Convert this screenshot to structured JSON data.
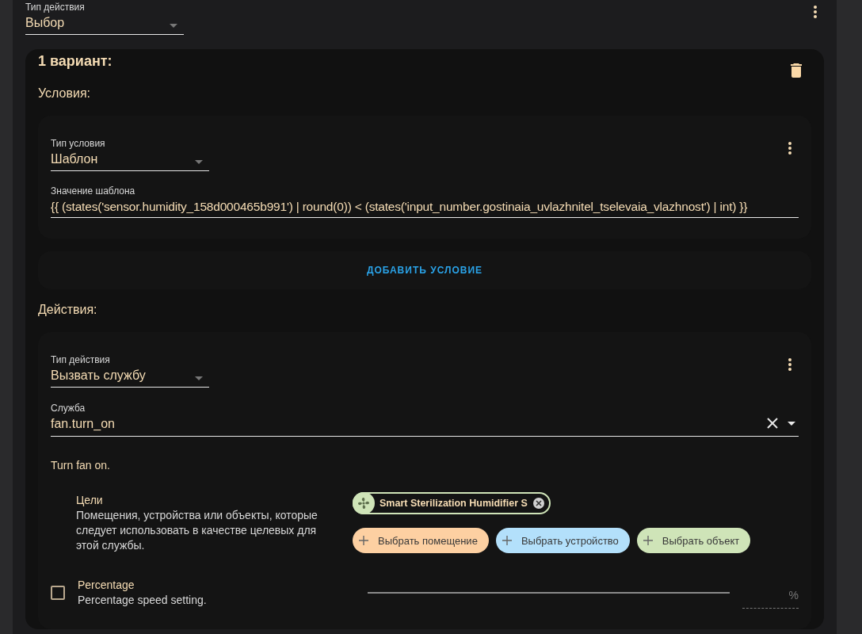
{
  "action_type": {
    "label": "Тип действия",
    "value": "Выбор"
  },
  "option": {
    "title": "1 вариант:",
    "conditions_heading": "Условия:",
    "conditions": [
      {
        "type_field": {
          "label": "Тип условия",
          "value": "Шаблон"
        },
        "template_field": {
          "label": "Значение шаблона",
          "value": "{{ (states('sensor.humidity_158d000465b991') | round(0)) < (states('input_number.gostinaia_uvlazhnitel_tselevaia_vlazhnost') | int) }}"
        }
      }
    ],
    "add_condition_button": "ДОБАВИТЬ УСЛОВИЕ",
    "actions_heading": "Действия:",
    "actions": [
      {
        "type_field": {
          "label": "Тип действия",
          "value": "Вызвать службу"
        },
        "service_field": {
          "label": "Служба",
          "value": "fan.turn_on"
        },
        "description": "Turn fan on.",
        "targets": {
          "title": "Цели",
          "description": "Помещения, устройства или объекты, которые следует использовать в качестве целевых для этой службы.",
          "chips": [
            {
              "label": "Smart Sterilization Humidifier S"
            }
          ],
          "add_buttons": [
            {
              "label": "Выбрать помещение",
              "color": "#fdd0a2"
            },
            {
              "label": "Выбрать устройство",
              "color": "#b3e0fb"
            },
            {
              "label": "Выбрать объект",
              "color": "#cfe4b8"
            }
          ]
        },
        "params": [
          {
            "name": "Percentage",
            "description": "Percentage speed setting.",
            "checked": false,
            "unit": "%"
          }
        ]
      }
    ]
  }
}
